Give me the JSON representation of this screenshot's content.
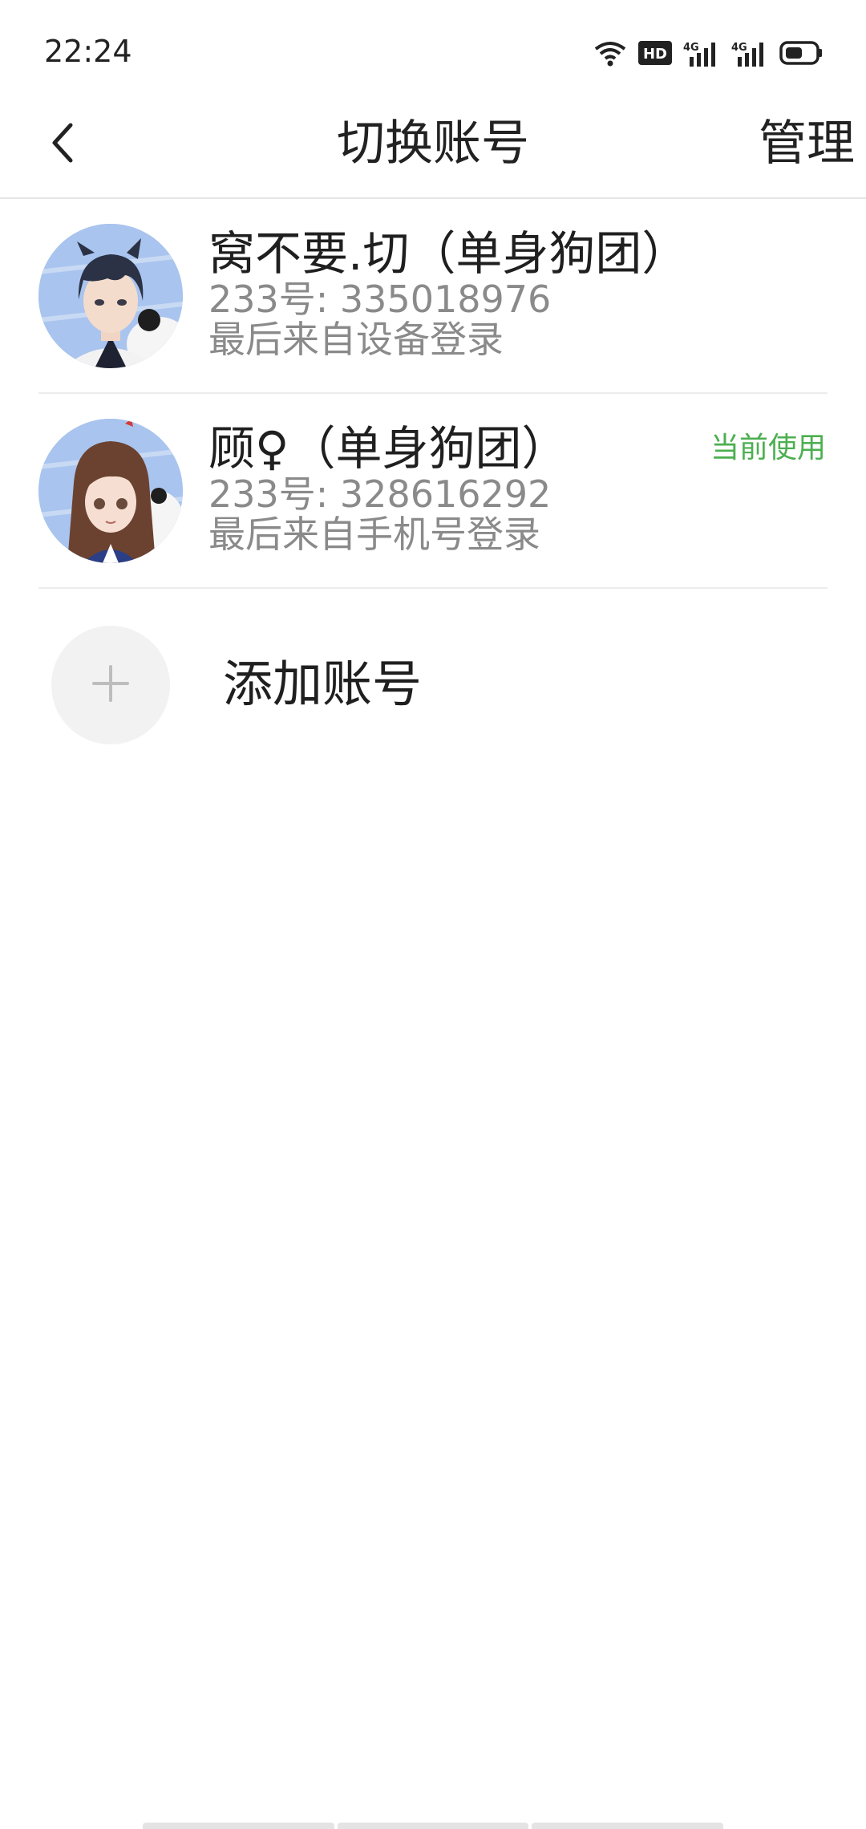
{
  "status_bar": {
    "time": "22:24",
    "icons": [
      "wifi-icon",
      "hd-icon",
      "signal-4g-icon",
      "signal-4g-icon",
      "battery-icon"
    ],
    "hd_label": "HD",
    "network_label": "4G"
  },
  "nav": {
    "back_icon": "chevron-left-icon",
    "title": "切换账号",
    "manage_label": "管理"
  },
  "accounts": [
    {
      "name": "窝不要.切（单身狗团）",
      "id_text": "233号: 335018976",
      "login_text": "最后来自设备登录",
      "current": false,
      "avatar": "avatar-boy"
    },
    {
      "name": "顾♀（单身狗团）",
      "id_text": "233号: 328616292",
      "login_text": "最后来自手机号登录",
      "current": true,
      "current_label": "当前使用",
      "avatar": "avatar-girl"
    }
  ],
  "add_account": {
    "icon": "plus-icon",
    "label": "添加账号"
  },
  "colors": {
    "accent_green": "#4caf50",
    "secondary_text": "#8a8a8a",
    "divider": "#ececec"
  }
}
